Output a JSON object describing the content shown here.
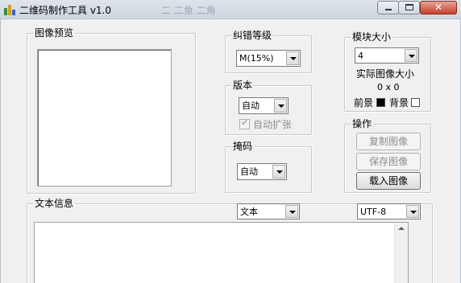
{
  "window": {
    "title": "二维码制作工具 v1.0",
    "title_ghost": "二 二鱼 二角"
  },
  "preview_group": {
    "label": "图像预览"
  },
  "ecc_group": {
    "label": "纠错等级",
    "value": "M(15%)"
  },
  "version_group": {
    "label": "版本",
    "value": "自动",
    "auto_expand_label": "自动扩张",
    "auto_expand_checked": true
  },
  "mask_group": {
    "label": "掩码",
    "value": "自动"
  },
  "module_group": {
    "label": "模块大小",
    "value": "4",
    "actual_size_label": "实际图像大小",
    "actual_size_value": "0 x 0",
    "foreground_label": "前景",
    "background_label": "背景",
    "foreground_color": "#000000",
    "background_color": "#ffffff"
  },
  "ops_group": {
    "label": "操作",
    "copy_image": "复制图像",
    "save_image": "保存图像",
    "load_image": "载入图像"
  },
  "text_group": {
    "label": "文本信息",
    "mode_value": "文本",
    "encoding_value": "UTF-8"
  }
}
